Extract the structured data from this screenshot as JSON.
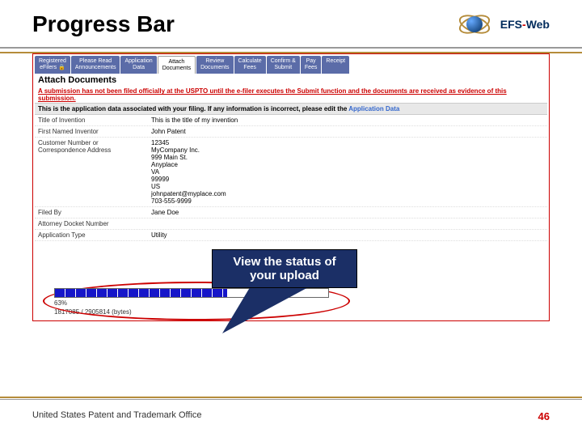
{
  "title": "Progress Bar",
  "logo": {
    "text_main": "EFS",
    "text_dash": "-",
    "text_sub": "Web"
  },
  "tabs": [
    "Registered\neFilers 🔒",
    "Please Read\nAnnouncements",
    "Application\nData",
    "Attach\nDocuments",
    "Review\nDocuments",
    "Calculate\nFees",
    "Confirm &\nSubmit",
    "Pay\nFees",
    "Receipt"
  ],
  "active_tab_index": 3,
  "section_heading": "Attach Documents",
  "warning": "A submission has not been filed officially at the USPTO until the e-filer executes the Submit function and the documents are received as evidence of this submission.",
  "info_line_prefix": "This is the application data associated with your filing. If any information is incorrect, please edit the ",
  "info_line_link": "Application Data",
  "fields": [
    {
      "label": "Title of Invention",
      "value": "This is the title of my invention"
    },
    {
      "label": "First Named Inventor",
      "value": "John Patent"
    },
    {
      "label": "Customer Number or\nCorrespondence Address",
      "value": "12345\nMyCompany Inc.\n999 Main St.\nAnyplace\nVA\n99999\nUS\njohnpatent@myplace.com\n703-555-9999"
    },
    {
      "label": "Filed By",
      "value": "Jane Doe"
    },
    {
      "label": "Attorney Docket Number",
      "value": ""
    },
    {
      "label": "Application Type",
      "value": "Utility"
    }
  ],
  "callout": "View the status of your upload",
  "progress": {
    "percent": 63,
    "percent_label": "63%",
    "bytes_label": "1817085 / 2905814 (bytes)"
  },
  "footer": "United States Patent and Trademark Office",
  "page_number": "46"
}
